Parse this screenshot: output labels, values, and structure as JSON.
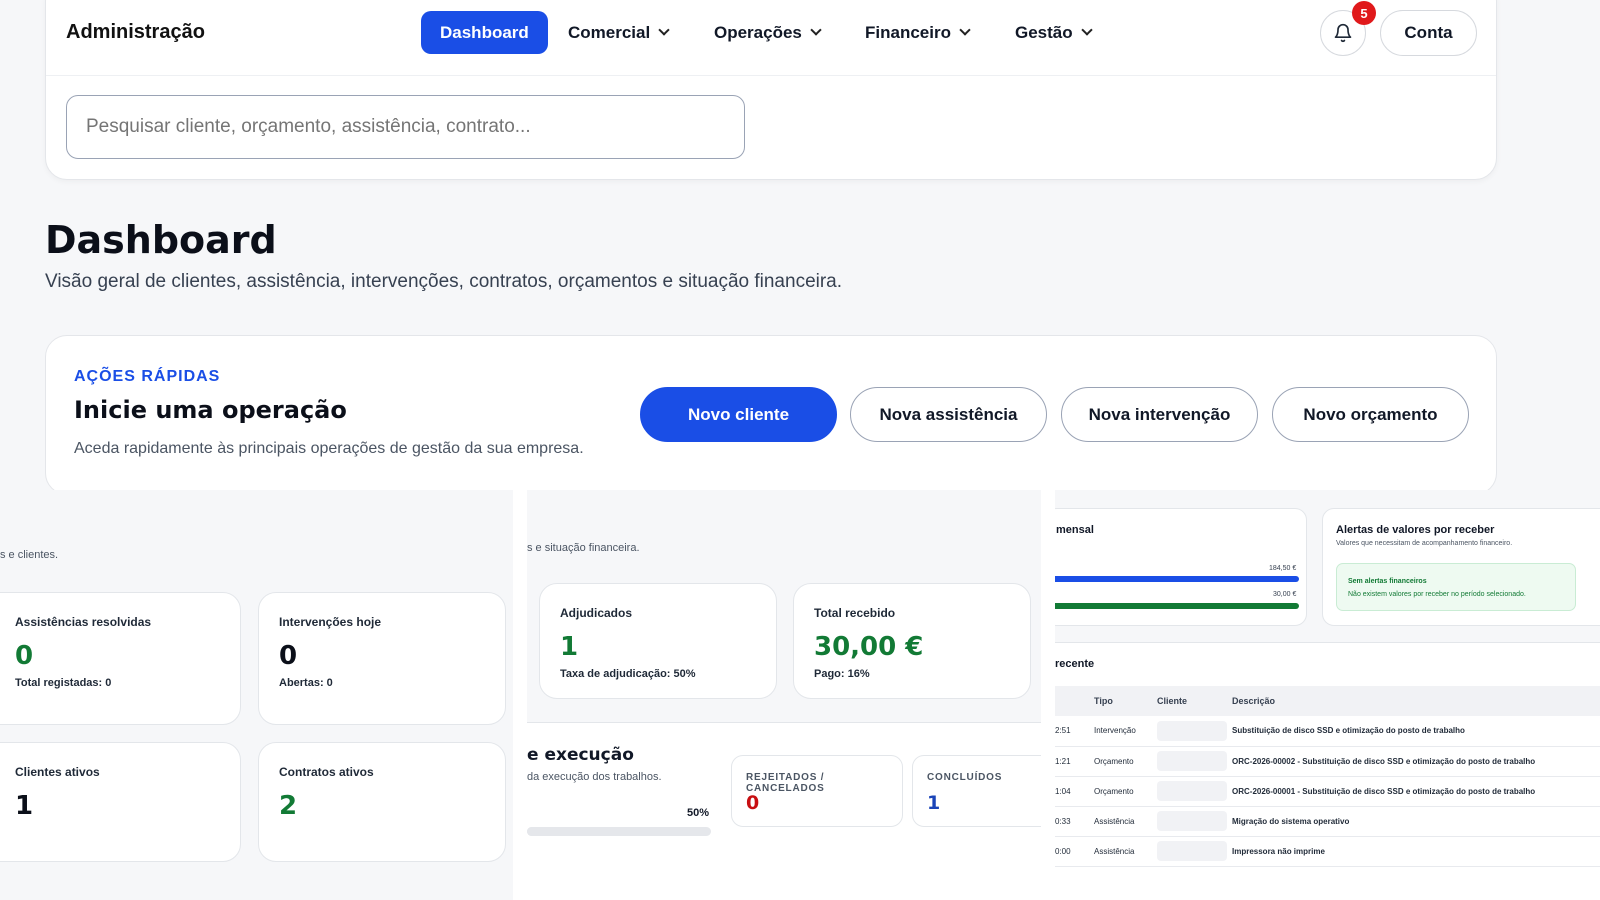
{
  "header": {
    "brand": "Administração",
    "nav": [
      {
        "label": "Dashboard",
        "active": true
      },
      {
        "label": "Comercial",
        "dropdown": true
      },
      {
        "label": "Operações",
        "dropdown": true
      },
      {
        "label": "Financeiro",
        "dropdown": true
      },
      {
        "label": "Gestão",
        "dropdown": true
      }
    ],
    "notifications_count": "5",
    "account_label": "Conta",
    "search_placeholder": "Pesquisar cliente, orçamento, assistência, contrato...",
    "accent": "#1a4ee6"
  },
  "page": {
    "title": "Dashboard",
    "subtitle": "Visão geral de clientes, assistência, intervenções, contratos, orçamentos e situação financeira."
  },
  "quick_actions": {
    "eyebrow": "AÇÕES RÁPIDAS",
    "title": "Inicie uma operação",
    "description": "Aceda rapidamente às principais operações de gestão da sua empresa.",
    "buttons": [
      "Novo cliente",
      "Nova assistência",
      "Nova intervenção",
      "Novo orçamento"
    ]
  },
  "panel1": {
    "subtitle_fragment": "s e clientes.",
    "stats": [
      {
        "label": "Assistências resolvidas",
        "value": "0",
        "meta": "Total registadas: 0",
        "color": "#127a35"
      },
      {
        "label": "Intervenções hoje",
        "value": "0",
        "meta": "Abertas: 0",
        "color": "#0b0f19"
      },
      {
        "label": "Clientes ativos",
        "value": "1",
        "meta": "",
        "color": "#0b0f19"
      },
      {
        "label": "Contratos ativos",
        "value": "2",
        "meta": "",
        "color": "#127a35"
      }
    ]
  },
  "panel2": {
    "subtitle_fragment": "s e situação financeira.",
    "stats": [
      {
        "label": "Adjudicados",
        "value": "1",
        "meta": "Taxa de adjudicação: 50%",
        "color": "#127a35"
      },
      {
        "label": "Total recebido",
        "value": "30,00 €",
        "meta": "Pago: 16%",
        "color": "#127a35"
      }
    ],
    "execution": {
      "title_fragment": "e execução",
      "desc_fragment": "da execução dos trabalhos.",
      "progress_label": "50%",
      "progress": 0.5
    },
    "mini": [
      {
        "label": "REJEITADOS / CANCELADOS",
        "value": "0",
        "color": "#c80f12"
      },
      {
        "label": "CONCLUÍDOS",
        "value": "1",
        "color": "#1a44b8"
      }
    ]
  },
  "panel3": {
    "monthly": {
      "title_fragment": "mensal",
      "bars": [
        {
          "label": "184,50 €",
          "value": 184.5,
          "color": "#1a4ee6"
        },
        {
          "label": "30,00 €",
          "value": 30.0,
          "color": "#127a35"
        }
      ]
    },
    "alerts": {
      "title": "Alertas de valores por receber",
      "subtitle": "Valores que necessitam de acompanhamento financeiro.",
      "box_title": "Sem alertas financeiros",
      "box_text": "Não existem valores por receber no período selecionado."
    },
    "recent": {
      "title_fragment": "recente",
      "columns": [
        "Tipo",
        "Cliente",
        "Descrição"
      ],
      "rows": [
        {
          "time": "2:51",
          "tipo": "Intervenção",
          "desc": "Substituição de disco SSD e otimização do posto de trabalho"
        },
        {
          "time": "1:21",
          "tipo": "Orçamento",
          "desc": "ORC-2026-00002 - Substituição de disco SSD e otimização do posto de trabalho"
        },
        {
          "time": "1:04",
          "tipo": "Orçamento",
          "desc": "ORC-2026-00001 - Substituição de disco SSD e otimização do posto de trabalho"
        },
        {
          "time": "0:33",
          "tipo": "Assistência",
          "desc": "Migração do sistema operativo"
        },
        {
          "time": "0:00",
          "tipo": "Assistência",
          "desc": "Impressora não imprime"
        }
      ]
    }
  }
}
